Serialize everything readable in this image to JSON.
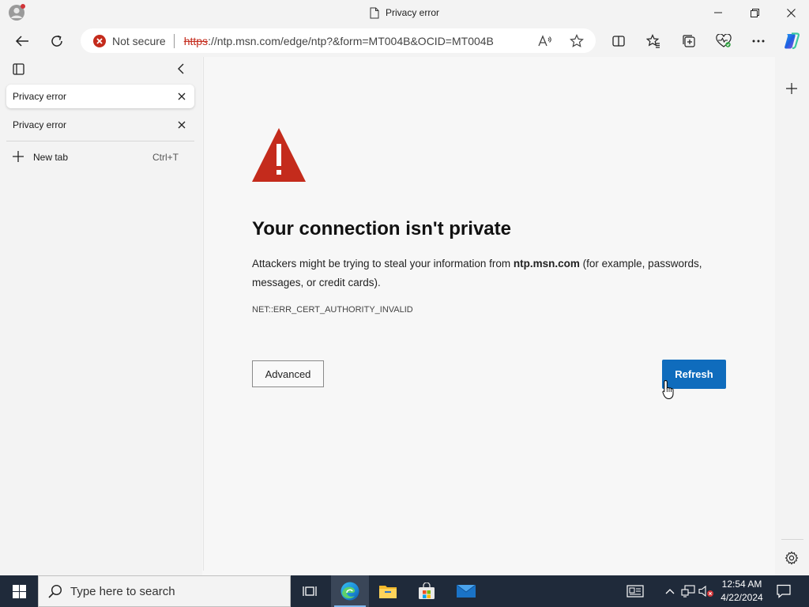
{
  "window": {
    "title": "Privacy error"
  },
  "toolbar": {
    "security_label": "Not secure",
    "url_protocol": "https",
    "url_rest": "://ntp.msn.com/edge/ntp?&form=MT004B&OCID=MT004B"
  },
  "sidebar": {
    "tabs": [
      {
        "label": "Privacy error",
        "active": true
      },
      {
        "label": "Privacy error",
        "active": false
      }
    ],
    "new_tab_label": "New tab",
    "new_tab_shortcut": "Ctrl+T"
  },
  "error_page": {
    "heading": "Your connection isn't private",
    "desc_before": "Attackers might be trying to steal your information from ",
    "desc_host": "ntp.msn.com",
    "desc_after": " (for example, passwords, messages, or credit cards).",
    "error_code": "NET::ERR_CERT_AUTHORITY_INVALID",
    "advanced_label": "Advanced",
    "refresh_label": "Refresh"
  },
  "taskbar": {
    "search_placeholder": "Type here to search",
    "time": "12:54 AM",
    "date": "4/22/2024"
  },
  "colors": {
    "danger": "#c42b1c",
    "accent": "#0f6cbd",
    "taskbar": "#1f2a3a"
  }
}
